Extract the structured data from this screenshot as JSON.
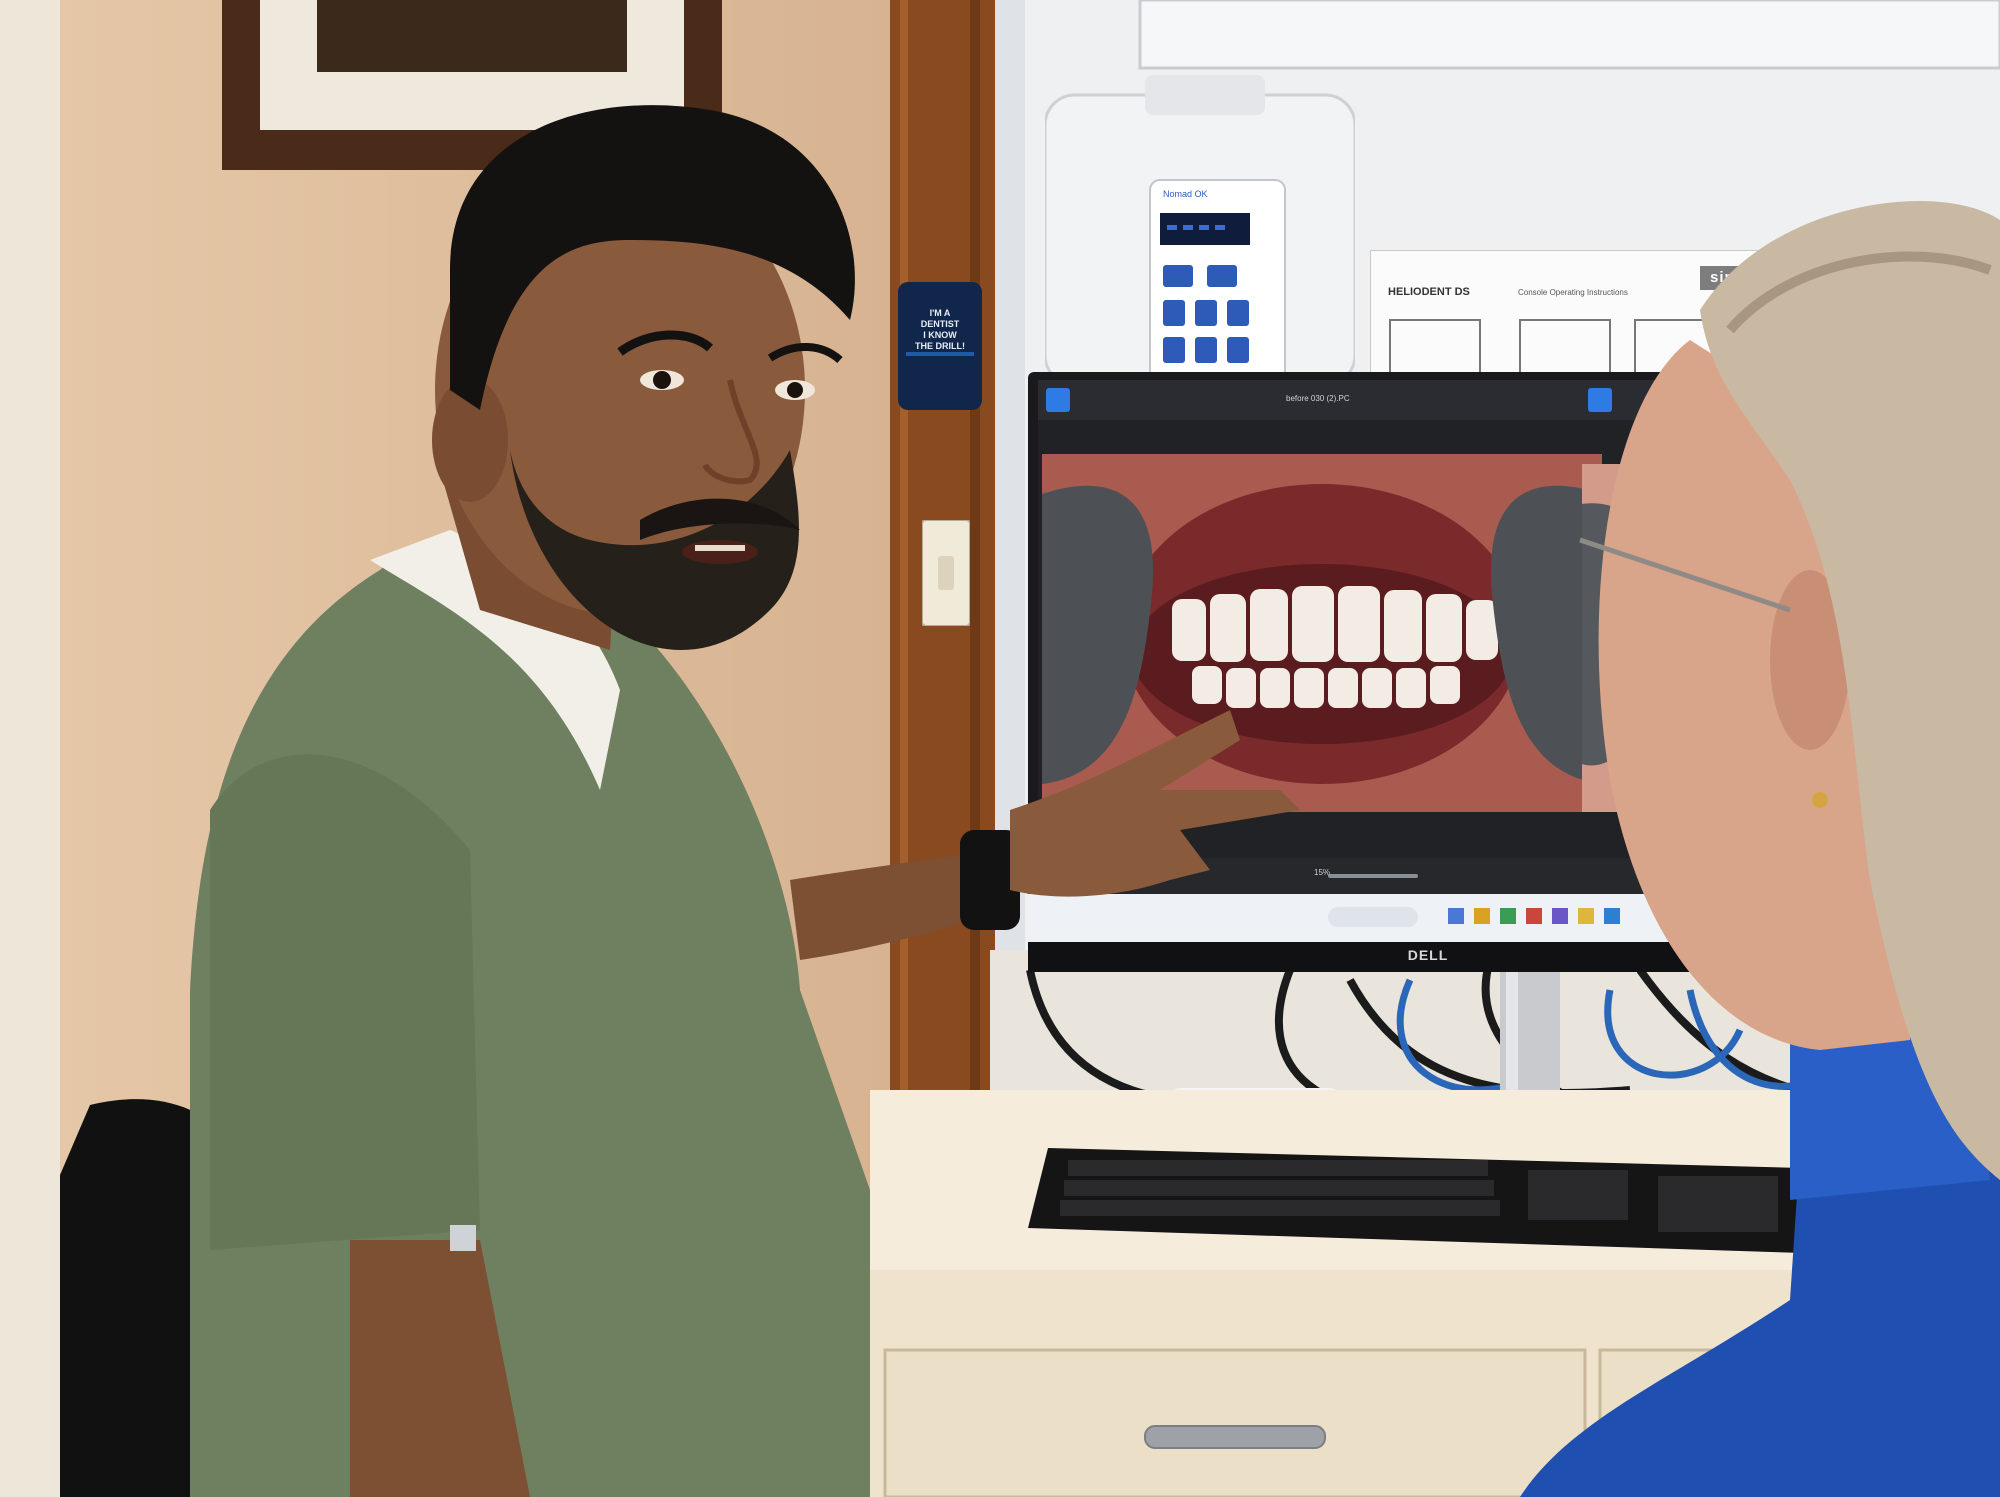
{
  "scene": {
    "colors": {
      "wall": "#d8b594",
      "wall_shadow": "#b58d6c",
      "wood_trim": "#8a4a1f",
      "cabinet": "#f3e8d4",
      "monitor_bezel": "#1a1a1c",
      "scrubs": "#6f8060",
      "skin": "#8a5a3c",
      "hair": "#141210",
      "patient_sweater": "#1f4fb0",
      "patient_hair": "#c9b8a2"
    },
    "monitor": {
      "brand": "DELL",
      "left_window_title": "before 030 (2).PC",
      "zoom_label": "15%"
    },
    "wall_device": {
      "brand": "Nomad OK",
      "display_value": "---"
    },
    "poster": {
      "title": "HELIODENT DS",
      "subtitle": "Console Operating Instructions",
      "brand": "sirona"
    },
    "badge_card": {
      "line1": "I'M A",
      "line2": "DENTIST",
      "line3": "I KNOW",
      "line4": "THE DRILL!"
    },
    "icons": [
      "play-icon",
      "search-icon",
      "taskbar-icons"
    ]
  }
}
